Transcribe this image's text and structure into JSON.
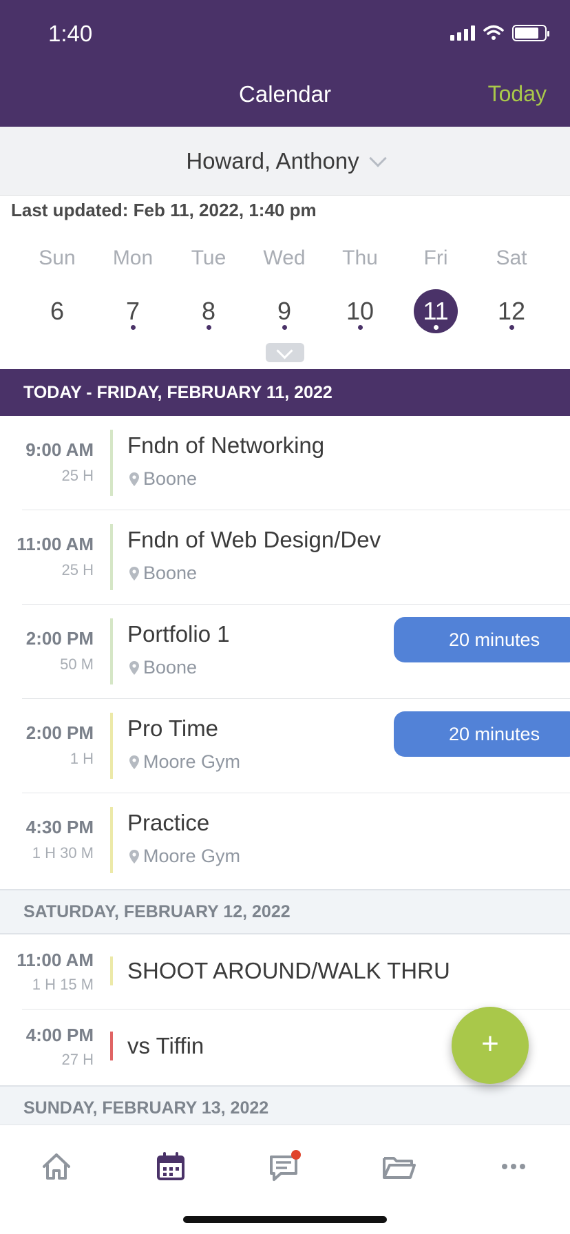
{
  "status_bar": {
    "time": "1:40"
  },
  "header": {
    "title": "Calendar",
    "today_label": "Today"
  },
  "person_selector": {
    "name": "Howard, Anthony"
  },
  "last_updated": "Last updated: Feb 11, 2022, 1:40 pm",
  "week": {
    "days": [
      {
        "name": "Sun",
        "num": "6",
        "has_event": false,
        "selected": false
      },
      {
        "name": "Mon",
        "num": "7",
        "has_event": true,
        "selected": false
      },
      {
        "name": "Tue",
        "num": "8",
        "has_event": true,
        "selected": false
      },
      {
        "name": "Wed",
        "num": "9",
        "has_event": true,
        "selected": false
      },
      {
        "name": "Thu",
        "num": "10",
        "has_event": true,
        "selected": false
      },
      {
        "name": "Fri",
        "num": "11",
        "has_event": true,
        "selected": true
      },
      {
        "name": "Sat",
        "num": "12",
        "has_event": true,
        "selected": false
      }
    ]
  },
  "sections": {
    "today": "TODAY - FRIDAY, FEBRUARY 11, 2022",
    "saturday": "SATURDAY, FEBRUARY 12, 2022",
    "sunday": "SUNDAY, FEBRUARY 13, 2022"
  },
  "events_today": [
    {
      "time": "9:00 AM",
      "duration": "25 H",
      "title": "Fndn of Networking",
      "location": "Boone",
      "bar_color": "#d5e6c6",
      "badge": ""
    },
    {
      "time": "11:00 AM",
      "duration": "25 H",
      "title": "Fndn of Web Design/Dev",
      "location": "Boone",
      "bar_color": "#d5e6c6",
      "badge": ""
    },
    {
      "time": "2:00 PM",
      "duration": "50 M",
      "title": "Portfolio 1",
      "location": "Boone",
      "bar_color": "#d5e6c6",
      "badge": "20 minutes"
    },
    {
      "time": "2:00 PM",
      "duration": "1 H",
      "title": "Pro Time",
      "location": "Moore Gym",
      "bar_color": "#ece9a8",
      "badge": "20 minutes"
    },
    {
      "time": "4:30 PM",
      "duration": "1 H 30 M",
      "title": "Practice",
      "location": "Moore Gym",
      "bar_color": "#ece9a8",
      "badge": ""
    }
  ],
  "events_saturday": [
    {
      "time": "11:00 AM",
      "duration": "1 H 15 M",
      "title": "SHOOT AROUND/WALK THRU",
      "bar_color": "#ece9a8"
    },
    {
      "time": "4:00 PM",
      "duration": "27 H",
      "title": "vs Tiffin",
      "bar_color": "#e06464"
    }
  ],
  "fab": {
    "label": "+"
  },
  "tabbar": {
    "items": [
      {
        "icon": "home-icon"
      },
      {
        "icon": "calendar-icon",
        "active": true
      },
      {
        "icon": "messages-icon",
        "has_notification": true
      },
      {
        "icon": "folder-icon"
      },
      {
        "icon": "more-icon"
      }
    ]
  },
  "colors": {
    "brand_purple": "#4a3268",
    "accent_green": "#a9c84a",
    "badge_blue": "#5282d7",
    "notification_red": "#e0442c"
  }
}
